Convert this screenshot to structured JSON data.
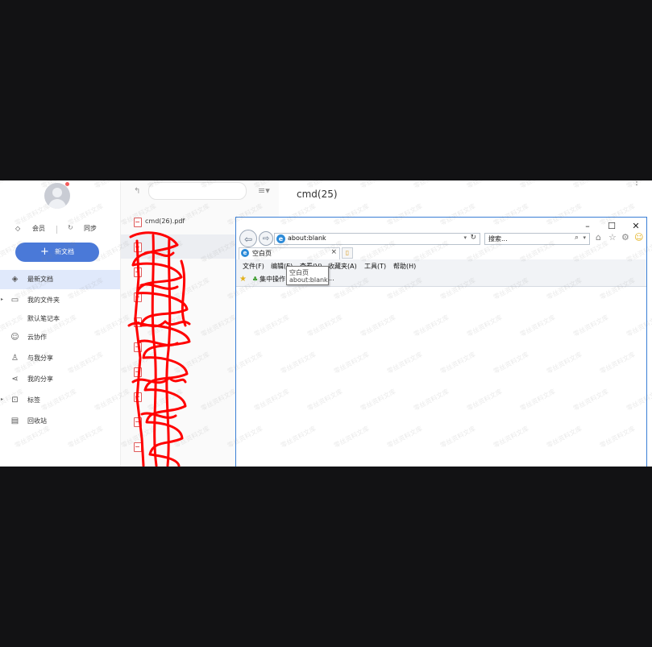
{
  "sidebar": {
    "member_label": "会员",
    "sync_label": "同步",
    "new_doc_label": "新文档",
    "items": [
      {
        "label": "最新文档",
        "icon": "layers-icon",
        "active": true
      },
      {
        "label": "我的文件夹",
        "icon": "folder-icon",
        "expandable": true
      },
      {
        "label": "默认笔记本",
        "icon": ""
      },
      {
        "label": "云协作",
        "icon": "people-icon"
      },
      {
        "label": "与我分享",
        "icon": "shared-user-icon"
      },
      {
        "label": "我的分享",
        "icon": "share-icon"
      },
      {
        "label": "标签",
        "icon": "tag-icon",
        "expandable": true
      },
      {
        "label": "回收站",
        "icon": "trash-icon"
      }
    ]
  },
  "filelist": {
    "files": [
      "cmd(26).pdf",
      "",
      "",
      "",
      "",
      "",
      "",
      "",
      "",
      ""
    ]
  },
  "document": {
    "title": "cmd(25)"
  },
  "browser": {
    "address": "about:blank",
    "search_placeholder": "搜索...",
    "tab_title": "空白页",
    "menu": [
      "文件(F)",
      "编辑(E)",
      "查看(V)",
      "收藏夹(A)",
      "工具(T)",
      "帮助(H)"
    ],
    "favorites_item": "集中操作",
    "favorites_more": "..."
  },
  "tooltip": {
    "line1": "空白页",
    "line2": "about:blank"
  },
  "watermark_text": "零丝资料文库",
  "colors": {
    "accent": "#4a79d8",
    "active_nav": "#e0e9fb",
    "scribble": "#ff0000",
    "window_border": "#3a7fd6"
  }
}
